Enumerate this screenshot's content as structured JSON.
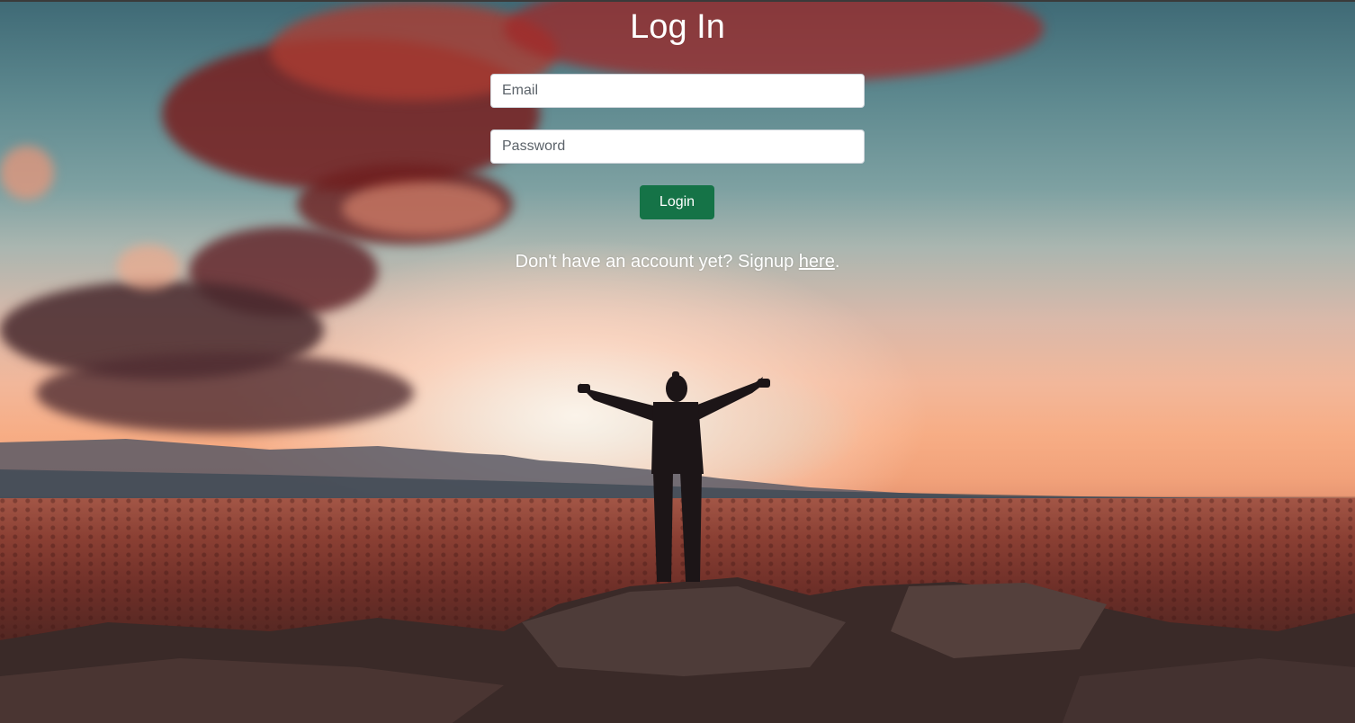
{
  "page": {
    "title": "Log In"
  },
  "form": {
    "email_placeholder": "Email",
    "email_value": "",
    "password_placeholder": "Password",
    "password_value": "",
    "login_label": "Login"
  },
  "signup": {
    "prefix": "Don't have an account yet? Signup ",
    "link_label": "here",
    "suffix": "."
  },
  "colors": {
    "login_button": "#157347",
    "text": "#ffffff"
  }
}
